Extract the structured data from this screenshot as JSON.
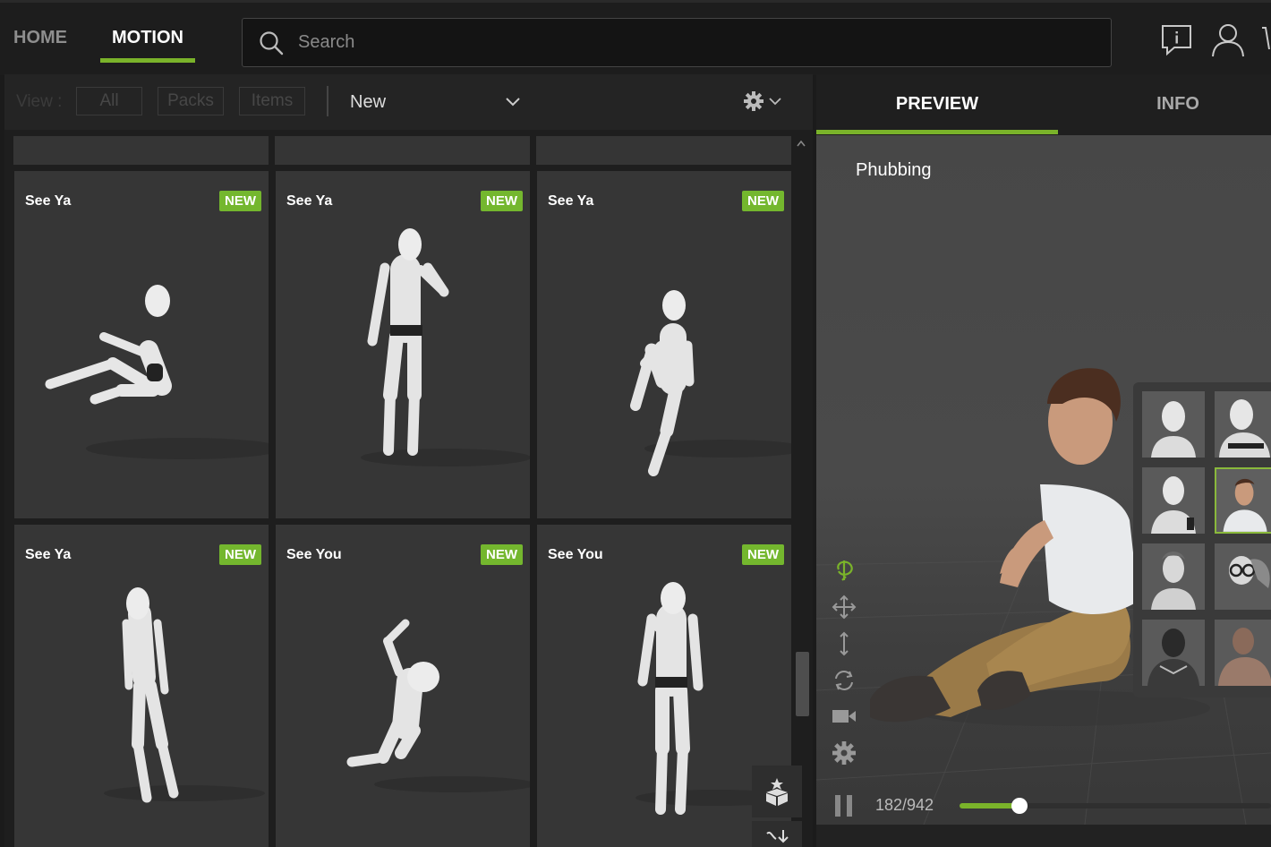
{
  "nav": {
    "tabs": [
      {
        "label": "HOME",
        "active": false
      },
      {
        "label": "MOTION",
        "active": true
      }
    ],
    "accent_color": "#7ab32a"
  },
  "search": {
    "placeholder": "Search",
    "value": "",
    "icon": "search-icon"
  },
  "top_icons": [
    "feedback-icon",
    "user-icon"
  ],
  "toolbar": {
    "view_label": "View :",
    "filters": [
      "All",
      "Packs",
      "Items"
    ],
    "sort_value": "New",
    "settings_icon": "gear-icon"
  },
  "cards": [
    {
      "title": "See Ya",
      "badge": "NEW"
    },
    {
      "title": "See Ya",
      "badge": "NEW"
    },
    {
      "title": "See Ya",
      "badge": "NEW"
    },
    {
      "title": "See Ya",
      "badge": "NEW"
    },
    {
      "title": "See You",
      "badge": "NEW"
    },
    {
      "title": "See You",
      "badge": "NEW"
    }
  ],
  "badge_color": "#74b72e",
  "right_panel": {
    "tabs": [
      {
        "label": "PREVIEW",
        "active": true
      },
      {
        "label": "INFO",
        "active": false
      }
    ],
    "animation_name": "Phubbing",
    "tools": [
      "rotate-view-icon",
      "move-icon",
      "vertical-move-icon",
      "reset-icon",
      "camera-icon",
      "gear-icon"
    ],
    "frame_display": "182/942",
    "playback": {
      "current_frame": 182,
      "total_frames": 942,
      "slider_fraction": 0.193
    }
  }
}
